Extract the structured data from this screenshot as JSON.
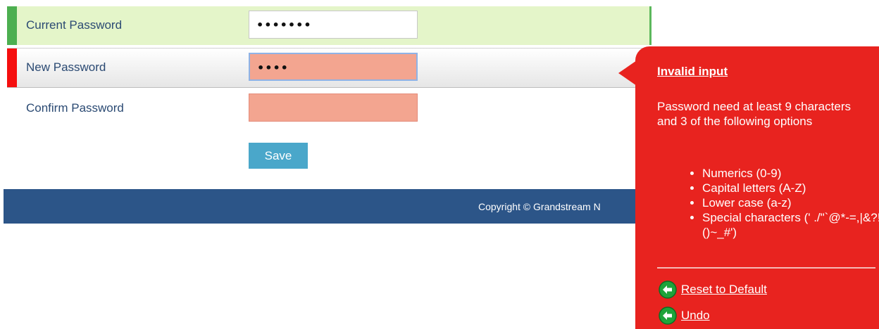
{
  "form": {
    "current": {
      "label": "Current Password",
      "value": "•••••••"
    },
    "new": {
      "label": "New Password",
      "value": "••••"
    },
    "confirm": {
      "label": "Confirm Password",
      "value": ""
    },
    "save_label": "Save"
  },
  "footer": {
    "copyright": "Copyright © Grandstream N"
  },
  "tooltip": {
    "title": "Invalid input",
    "description": "Password need at least 9 characters and 3 of the following options",
    "options": [
      "Numerics (0-9)",
      "Capital letters (A-Z)",
      "Lower case (a-z)",
      "Special characters (' ./\"`@*-=,|&?!%()~_#')"
    ],
    "links": {
      "reset": "Reset to Default",
      "undo": "Undo"
    },
    "colors": {
      "background": "#e8231f",
      "icon": "#1fa33a"
    },
    "icons": {
      "reset": "arrow-left-icon",
      "undo": "arrow-left-icon"
    }
  },
  "colors": {
    "valid_bar": "#4caf50",
    "invalid_bar": "#f50f0f",
    "invalid_field": "#f3a590",
    "save_button": "#4aa7ca",
    "footer": "#2c5588"
  }
}
